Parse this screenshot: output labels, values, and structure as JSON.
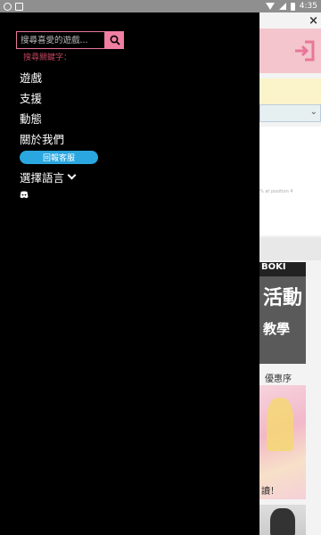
{
  "status_bar": {
    "time": "4:35",
    "left_icons": [
      "media-icon",
      "notification-icon"
    ],
    "right_icons": [
      "wifi-icon",
      "signal-icon",
      "battery-icon"
    ]
  },
  "drawer": {
    "search": {
      "placeholder": "搜尋喜愛的遊戲..."
    },
    "hot_label": "搜尋關鍵字：",
    "nav": {
      "games": "遊戲",
      "support": "支援",
      "news": "動態",
      "about": "關於我們"
    },
    "support_button": "回報客服",
    "language_select": "選擇語言",
    "social": [
      "discord-icon"
    ]
  },
  "background_page": {
    "close": "×",
    "banner_top": "BOKI",
    "banner_title": "活動",
    "banner_subtitle": "教學",
    "promo": "優惠序",
    "art_caption": "讀！",
    "faded_text": "% at position 4"
  },
  "colors": {
    "drawer_bg": "#000000",
    "search_accent": "#f07fa3",
    "support_button": "#2aa7e0",
    "hot_label": "#c0445e",
    "header_pink": "#f4c5cc"
  }
}
